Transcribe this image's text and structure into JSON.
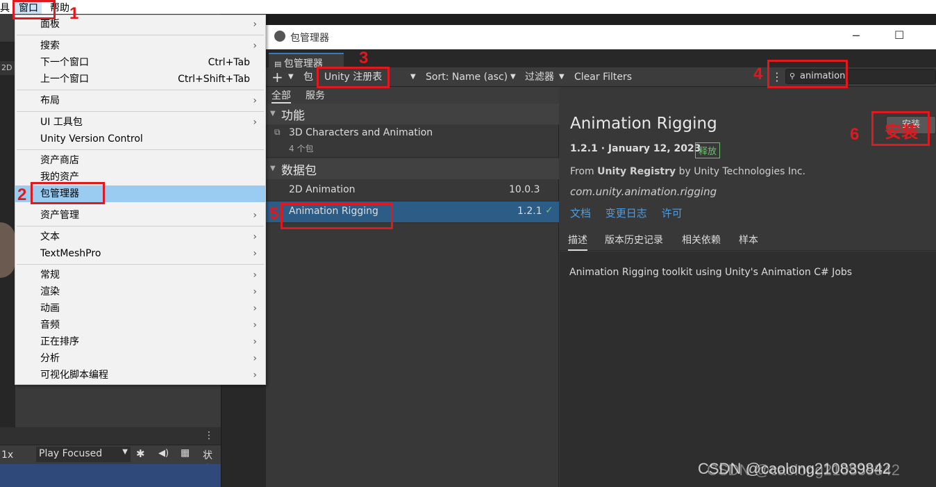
{
  "menubar": {
    "tools": "具",
    "window": "窗口",
    "help": "帮助"
  },
  "left_editor": {
    "label_2d": "2D",
    "zoom": "1x",
    "play_focused": "Play Focused",
    "status": "状态"
  },
  "dropdown": {
    "items": [
      {
        "label": "面板",
        "submenu": true
      },
      {
        "label": "搜索",
        "submenu": true
      },
      {
        "label": "下一个窗口",
        "shortcut": "Ctrl+Tab"
      },
      {
        "label": "上一个窗口",
        "shortcut": "Ctrl+Shift+Tab"
      },
      {
        "label": "布局",
        "submenu": true
      },
      {
        "label": "UI 工具包",
        "submenu": true
      },
      {
        "label": "Unity Version Control"
      },
      {
        "label": "资产商店"
      },
      {
        "label": "我的资产"
      },
      {
        "label": "包管理器",
        "highlighted": true
      },
      {
        "label": "资产管理",
        "submenu": true
      },
      {
        "label": "文本",
        "submenu": true
      },
      {
        "label": "TextMeshPro",
        "submenu": true
      },
      {
        "label": "常规",
        "submenu": true
      },
      {
        "label": "渲染",
        "submenu": true
      },
      {
        "label": "动画",
        "submenu": true
      },
      {
        "label": "音频",
        "submenu": true
      },
      {
        "label": "正在排序",
        "submenu": true
      },
      {
        "label": "分析",
        "submenu": true
      },
      {
        "label": "可视化脚本编程",
        "submenu": true
      }
    ],
    "arrow": "›"
  },
  "package_manager": {
    "window_title": "包管理器",
    "tab_label": "包管理器",
    "toolbar": {
      "add": "+",
      "packages_prefix": "包",
      "registry": "Unity 注册表",
      "sort": "Sort: Name (asc)",
      "filters": "过滤器",
      "clear_filters": "Clear Filters",
      "search_value": "animation"
    },
    "filter_tabs": {
      "all": "全部",
      "services": "服务"
    },
    "groups": {
      "features": "功能",
      "feature_item": "3D Characters and Animation",
      "feature_count": "4 个包",
      "packages": "数据包"
    },
    "packages": [
      {
        "name": "2D Animation",
        "version": "10.0.3"
      },
      {
        "name": "Animation Rigging",
        "version": "1.2.1",
        "selected": true
      }
    ],
    "detail": {
      "title": "Animation Rigging",
      "version_date": "1.2.1 · January 12, 2023",
      "badge": "释放",
      "from_prefix": "From ",
      "registry": "Unity Registry",
      "from_suffix": " by Unity Technologies Inc.",
      "package_id": "com.unity.animation.rigging",
      "links": [
        "文档",
        "变更日志",
        "许可"
      ],
      "tabs": [
        "描述",
        "版本历史记录",
        "相关依赖",
        "样本"
      ],
      "description": "Animation Rigging toolkit using Unity's Animation C# Jobs",
      "install_button": "安装"
    }
  },
  "annotations": {
    "n1": "1",
    "n2": "2",
    "n3": "3",
    "n4": "4",
    "n5": "5",
    "n6": "6",
    "install_label": "安装"
  },
  "watermark": "CSDN @caolong210839842",
  "colors": {
    "annotation": "#e0191e",
    "selection": "#2c5d87",
    "highlight": "#99ccf0",
    "link": "#4c9ee8",
    "badge": "#6cc070"
  }
}
